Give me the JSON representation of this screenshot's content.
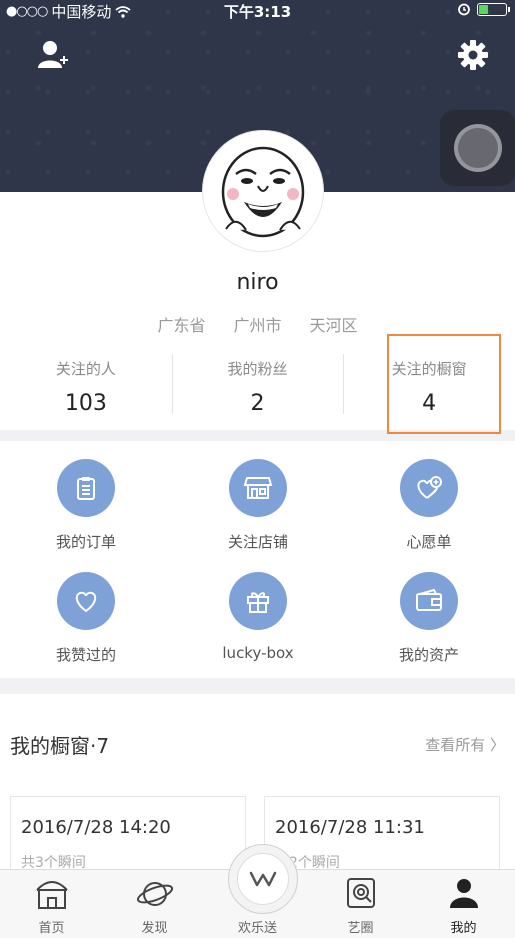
{
  "status_bar": {
    "carrier": "中国移动",
    "signal_dots": "●○○○",
    "time": "下午3:13"
  },
  "profile": {
    "name": "niro",
    "location": [
      "广东省",
      "广州市",
      "天河区"
    ],
    "stats": [
      {
        "label": "关注的人",
        "value": "103"
      },
      {
        "label": "我的粉丝",
        "value": "2"
      },
      {
        "label": "关注的橱窗",
        "value": "4"
      }
    ]
  },
  "grid": [
    {
      "label": "我的订单",
      "icon": "clipboard-icon"
    },
    {
      "label": "关注店铺",
      "icon": "shop-icon"
    },
    {
      "label": "心愿单",
      "icon": "heart-plus-icon"
    },
    {
      "label": "我赞过的",
      "icon": "heart-icon"
    },
    {
      "label": "lucky-box",
      "icon": "gift-icon"
    },
    {
      "label": "我的资产",
      "icon": "wallet-icon"
    }
  ],
  "windows": {
    "title": "我的橱窗·7",
    "more": "查看所有 〉",
    "cards": [
      {
        "date": "2016/7/28 14:20",
        "sub": "共3个瞬间"
      },
      {
        "date": "2016/7/28 11:31",
        "sub": "共2个瞬间"
      }
    ]
  },
  "tabs": [
    {
      "label": "首页",
      "icon": "home-icon"
    },
    {
      "label": "发现",
      "icon": "planet-icon"
    },
    {
      "label": "欢乐送",
      "icon": "w-logo-icon"
    },
    {
      "label": "艺圈",
      "icon": "circle-icon"
    },
    {
      "label": "我的",
      "icon": "user-icon"
    }
  ],
  "colors": {
    "header": "#2f3649",
    "accent": "#7ea1d8",
    "highlight": "#ee8a3e"
  }
}
